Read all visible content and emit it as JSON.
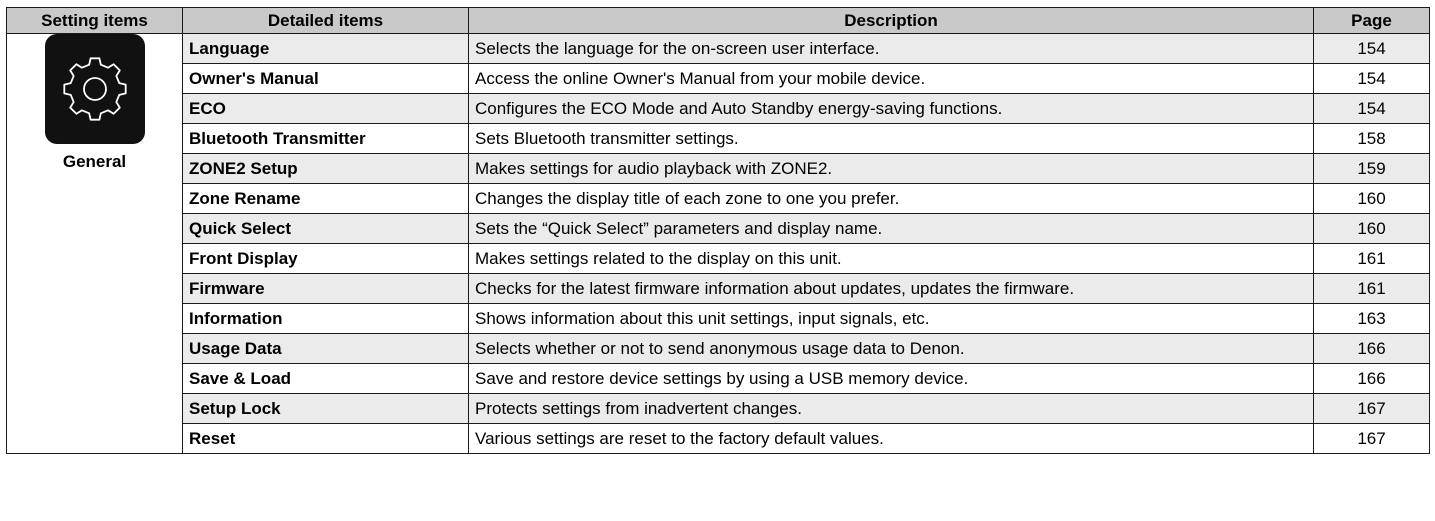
{
  "table": {
    "headers": {
      "setting_items": "Setting items",
      "detailed_items": "Detailed items",
      "description": "Description",
      "page": "Page"
    },
    "group": {
      "label": "General",
      "icon": "gear-icon"
    },
    "rows": [
      {
        "item": "Language",
        "description": "Selects the language for the on-screen user interface.",
        "page": "154"
      },
      {
        "item": "Owner's Manual",
        "description": "Access the online Owner's Manual from your mobile device.",
        "page": "154"
      },
      {
        "item": "ECO",
        "description": "Configures the ECO Mode and Auto Standby energy-saving functions.",
        "page": "154"
      },
      {
        "item": "Bluetooth Transmitter",
        "description": "Sets Bluetooth transmitter settings.",
        "page": "158"
      },
      {
        "item": "ZONE2 Setup",
        "description": "Makes settings for audio playback with ZONE2.",
        "page": "159"
      },
      {
        "item": "Zone Rename",
        "description": "Changes the display title of each zone to one you prefer.",
        "page": "160"
      },
      {
        "item": "Quick Select",
        "description": "Sets the “Quick Select” parameters and display name.",
        "page": "160"
      },
      {
        "item": "Front Display",
        "description": "Makes settings related to the display on this unit.",
        "page": "161"
      },
      {
        "item": "Firmware",
        "description": "Checks for the latest firmware information about updates, updates the firmware.",
        "page": "161"
      },
      {
        "item": "Information",
        "description": "Shows information about this unit settings, input signals, etc.",
        "page": "163"
      },
      {
        "item": "Usage Data",
        "description": "Selects whether or not to send anonymous usage data to Denon.",
        "page": "166"
      },
      {
        "item": "Save & Load",
        "description": "Save and restore device settings by using a USB memory device.",
        "page": "166"
      },
      {
        "item": "Setup Lock",
        "description": "Protects settings from inadvertent changes.",
        "page": "167"
      },
      {
        "item": "Reset",
        "description": "Various settings are reset to the factory default values.",
        "page": "167"
      }
    ]
  }
}
